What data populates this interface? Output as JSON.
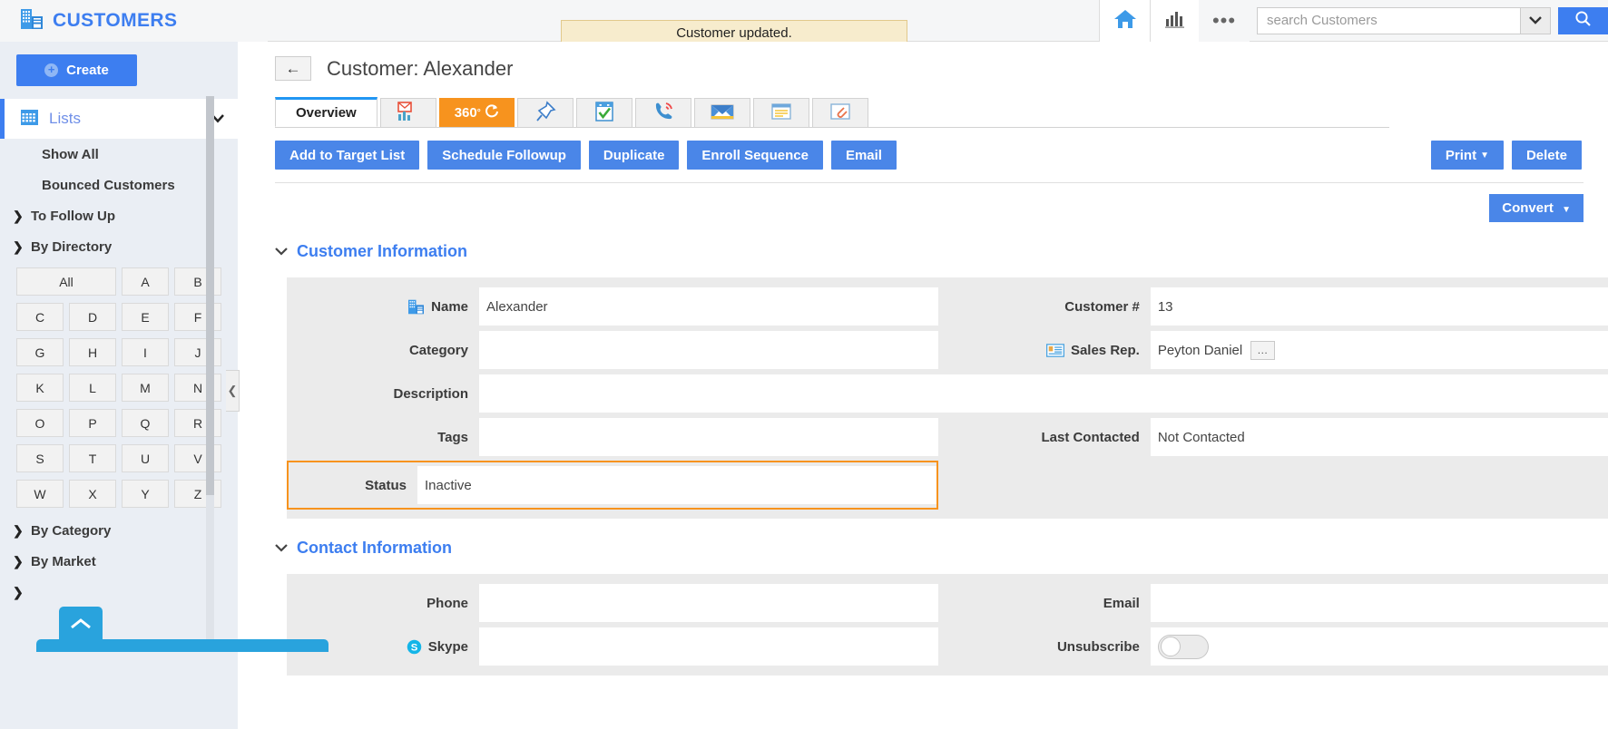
{
  "app": {
    "brand_title": "CUSTOMERS",
    "brand_icon": "building-icon"
  },
  "topbar": {
    "notification": "Customer updated.",
    "home_icon": "home-icon",
    "reports_icon": "bar-chart-icon",
    "more_icon": "ellipsis-icon",
    "search": {
      "placeholder": "search Customers",
      "value": "",
      "caret_icon": "chevron-down-icon",
      "button_icon": "search-icon"
    }
  },
  "sidebar": {
    "create_label": "Create",
    "lists_label": "Lists",
    "lists_icon": "grid-icon",
    "items": [
      {
        "label": "Show All",
        "type": "link"
      },
      {
        "label": "Bounced Customers",
        "type": "link"
      },
      {
        "label": "To Follow Up",
        "type": "group",
        "expanded": false
      },
      {
        "label": "By Directory",
        "type": "group",
        "expanded": true
      }
    ],
    "directory_letters": [
      "All",
      "A",
      "B",
      "C",
      "D",
      "E",
      "F",
      "G",
      "H",
      "I",
      "J",
      "K",
      "L",
      "M",
      "N",
      "O",
      "P",
      "Q",
      "R",
      "S",
      "T",
      "U",
      "V",
      "W",
      "X",
      "Y",
      "Z"
    ],
    "trailing_items": [
      {
        "label": "By Category",
        "type": "group",
        "expanded": false
      },
      {
        "label": "By Market",
        "type": "group",
        "expanded": false
      }
    ],
    "collapse_icon": "chevron-left-icon",
    "scroll_top_icon": "chevron-up-icon"
  },
  "record": {
    "back_icon": "arrow-left-icon",
    "title": "Customer: Alexander",
    "tabs": [
      {
        "label": "Overview",
        "icon": "",
        "state": "active"
      },
      {
        "label": "",
        "icon": "email-chart-icon",
        "state": "normal"
      },
      {
        "label": "360",
        "icon": "360-refresh-icon",
        "state": "orange"
      },
      {
        "label": "",
        "icon": "pin-icon",
        "state": "normal"
      },
      {
        "label": "",
        "icon": "task-check-icon",
        "state": "normal"
      },
      {
        "label": "",
        "icon": "phone-call-icon",
        "state": "normal"
      },
      {
        "label": "",
        "icon": "envelope-icon",
        "state": "normal"
      },
      {
        "label": "",
        "icon": "note-icon",
        "state": "normal"
      },
      {
        "label": "",
        "icon": "attachment-icon",
        "state": "normal"
      }
    ],
    "actions": [
      {
        "label": "Add to Target List"
      },
      {
        "label": "Schedule Followup"
      },
      {
        "label": "Duplicate"
      },
      {
        "label": "Enroll Sequence"
      },
      {
        "label": "Email"
      }
    ],
    "print_label": "Print",
    "delete_label": "Delete",
    "convert_label": "Convert"
  },
  "customer_information": {
    "heading": "Customer Information",
    "fields": [
      {
        "label": "Name",
        "value": "Alexander",
        "icon": "building-icon"
      },
      {
        "label": "Customer #",
        "value": "13",
        "icon": ""
      },
      {
        "label": "Category",
        "value": "",
        "icon": ""
      },
      {
        "label": "Sales Rep.",
        "value": "Peyton Daniel",
        "icon": "contact-card-icon",
        "has_ellipsis": true
      },
      {
        "label": "Description",
        "value": "",
        "icon": ""
      },
      {
        "label": "Tags",
        "value": "",
        "icon": ""
      },
      {
        "label": "Last Contacted",
        "value": "Not Contacted",
        "icon": ""
      },
      {
        "label": "Status",
        "value": "Inactive",
        "icon": "",
        "highlighted": true
      }
    ]
  },
  "contact_information": {
    "heading": "Contact Information",
    "fields": [
      {
        "label": "Phone",
        "value": "",
        "icon": ""
      },
      {
        "label": "Email",
        "value": "",
        "icon": ""
      },
      {
        "label": "Skype",
        "value": "",
        "icon": "skype-icon"
      },
      {
        "label": "Unsubscribe",
        "value": "",
        "icon": "",
        "control": "toggle",
        "toggle_on": false
      }
    ]
  },
  "colors": {
    "accent_blue": "#3d7ef0",
    "button_blue": "#4a86e8",
    "orange": "#f7931e",
    "notice_bg": "#f7eccd",
    "notice_border": "#e2c98c",
    "sidebar_bg": "#eaeef4",
    "panel_bg": "#ebebeb",
    "bottom_bar": "#29a3dd"
  }
}
